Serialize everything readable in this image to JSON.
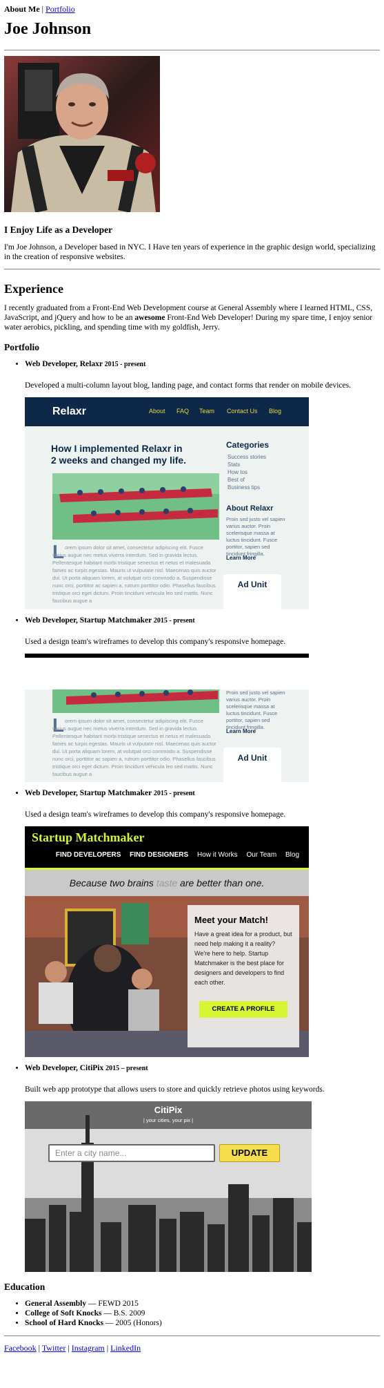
{
  "nav": {
    "current": "About Me",
    "separator": "|",
    "link": "Portfolio"
  },
  "name": "Joe Johnson",
  "tagline": "I Enjoy Life as a Developer",
  "intro": "I'm Joe Johnson, a Developer based in NYC. I Have ten years of experience in the graphic design world, specializing in the creation of responsive websites.",
  "experience": {
    "heading": "Experience",
    "text_before": "I recently graduated from a Front-End Web Development course at General Assembly where I learned HTML, CSS, JavaScript, and jQuery and how to be an ",
    "text_bold": "awesome",
    "text_after": " Front-End Web Developer! During my spare time, I enjoy senior water aerobics, pickling, and spending time with my goldfish, Jerry."
  },
  "portfolio": {
    "heading": "Portfolio",
    "jobs": [
      {
        "title": "Web Developer, Relaxr",
        "dates": "2015 - present",
        "desc": "Developed a multi-column layout blog, landing page, and contact forms that render on mobile devices."
      },
      {
        "title": "Web Developer, Startup Matchmaker",
        "dates": "2015 - present",
        "desc": "Used a design team's wireframes to develop this company's responsive homepage."
      },
      {
        "title": "Web Developer, Startup Matchmaker",
        "dates": "2015 - present",
        "desc": "Used a design team's wireframes to develop this company's responsive homepage."
      },
      {
        "title": "Web Developer, CitiPix",
        "dates": "2015 – present",
        "desc": "Built web app prototype that allows users to store and quickly retrieve photos using keywords."
      }
    ]
  },
  "relaxr": {
    "logo": "Relaxr",
    "nav": [
      "About",
      "FAQ",
      "Team",
      "Contact Us",
      "Blog"
    ],
    "headline": "How I implemented Relaxr in 2 weeks and changed my life.",
    "categories_title": "Categories",
    "categories": [
      "Success stories",
      "Stats",
      "How tos",
      "Best of",
      "Business tips"
    ],
    "about_title": "About Relaxr",
    "about_text": "Proin sed justo vel sapien varius auctor. Proin scelerisque massa at luctus tincidunt. Fusce portitor, sapien sed tincidunt fringilla.",
    "learn_more": "Learn More",
    "dropcap": "L",
    "body_text": "orem ipsum dolor sit amet, consectetur adipiscing elit. Fusce varius augue nec metus viverra interdum. Sed in gravida lectus. Pellentesque habitant morbi tristique senectus et netus et malesuada fames ac turpis egestas. Mauris ut vulputate nisl. Maecenas quis auctor dui. Ut porta aliquam lorem, at volutpat orci commodo a. Suspendisse nunc orci, porttitor ac sapien a, rutrum porttitor odio. Phasellus faucibus tristique orci eget dictum. Proin tincidunt vehicula leo sed mattis. Nunc faucibus augue a",
    "ad_unit": "Ad Unit"
  },
  "matchmaker": {
    "logo": "Startup Matchmaker",
    "nav": [
      "FIND DEVELOPERS",
      "FIND DESIGNERS",
      "How it Works",
      "Our Team",
      "Blog"
    ],
    "banner_before": "Because two brains ",
    "banner_strike": "taste",
    "banner_after": " are better than one.",
    "card_title": "Meet your Match!",
    "card_text": "Have a great idea for a product, but need help making it a reality? We're here to help. Startup Matchmaker is the best place for designers and developers to find each other.",
    "cta": "CREATE A PROFILE"
  },
  "citipix": {
    "logo": "CitiPix",
    "tagline": "| your cities, your pix |",
    "placeholder": "Enter a city name...",
    "button": "UPDATE"
  },
  "education": {
    "heading": "Education",
    "items": [
      {
        "school": "General Assembly",
        "detail": " — FEWD 2015"
      },
      {
        "school": "College of Soft Knocks",
        "detail": " — B.S. 2009"
      },
      {
        "school": "School of Hard Knocks",
        "detail": " — 2005 (Honors)"
      }
    ]
  },
  "footer": {
    "links": [
      "Facebook",
      "Twitter",
      "Instagram",
      "LinkedIn"
    ],
    "separator": "|"
  },
  "colors": {
    "relaxr_navy": "#0d2849",
    "relaxr_yellow": "#e9d63b",
    "matchmaker_lime": "#d6f533",
    "citipix_yellow": "#f5dd4b"
  }
}
